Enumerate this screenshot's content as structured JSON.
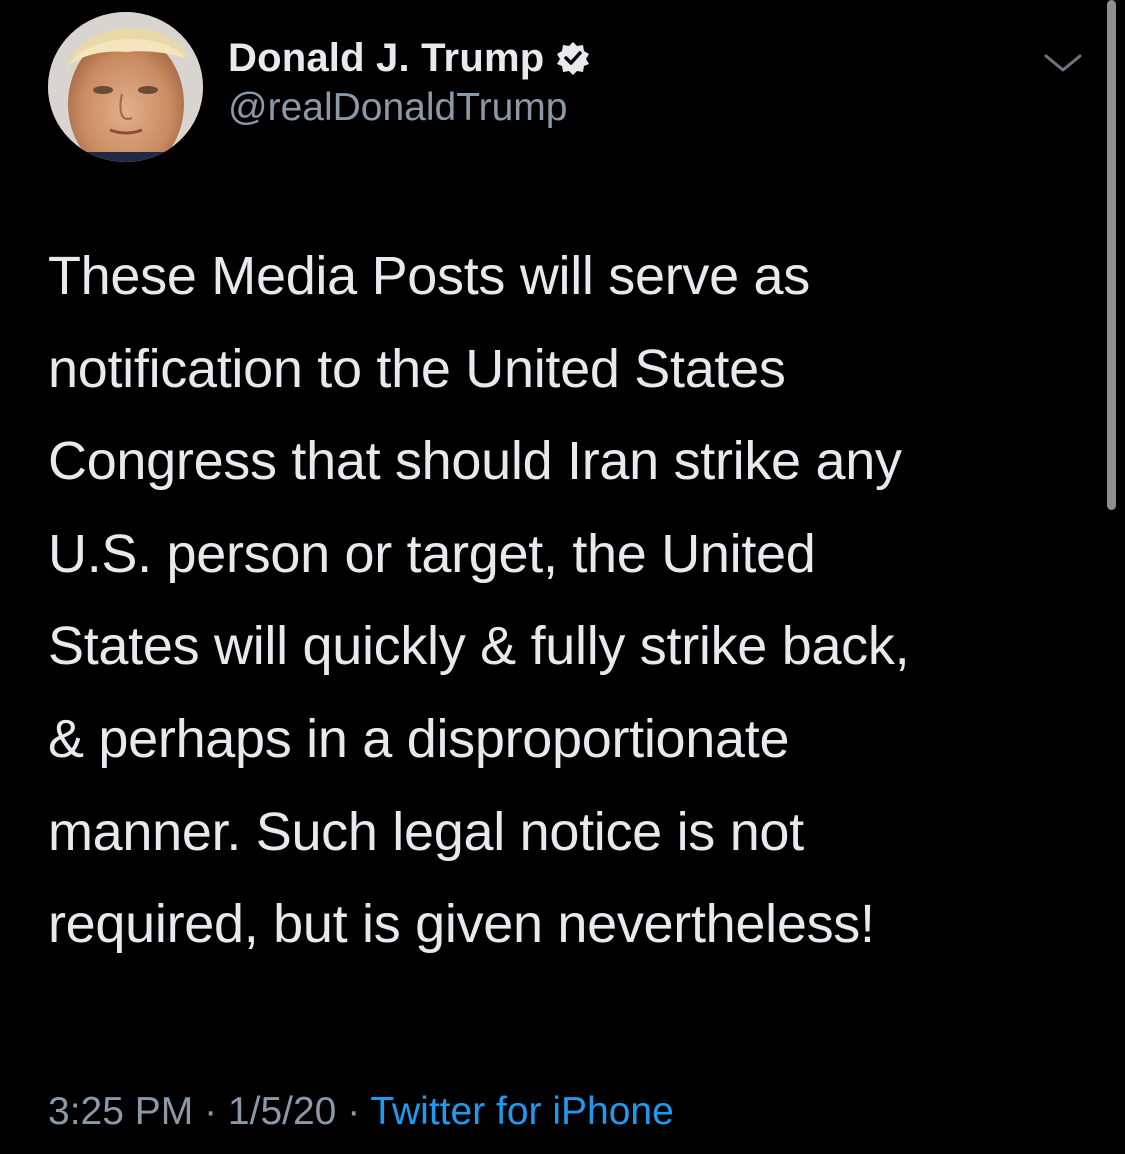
{
  "author": {
    "display_name": "Donald J. Trump",
    "handle": "@realDonaldTrump",
    "verified_icon": "verified-badge-icon",
    "avatar": "profile-photo"
  },
  "tweet": {
    "text": "These Media Posts will serve as\nnotification to the United States\nCongress that should Iran strike any\nU.S. person or target, the United\nStates will quickly & fully strike back,\n& perhaps in a disproportionate\nmanner. Such legal notice is not\nrequired, but is given nevertheless!"
  },
  "meta": {
    "time": "3:25 PM",
    "separator": " · ",
    "date": "1/5/20",
    "source": "Twitter for iPhone"
  },
  "menu": {
    "icon": "chevron-down-icon"
  },
  "colors": {
    "background": "#000000",
    "text": "#e7e9ea",
    "secondary": "#8b98a5",
    "link": "#1d9bf0"
  }
}
